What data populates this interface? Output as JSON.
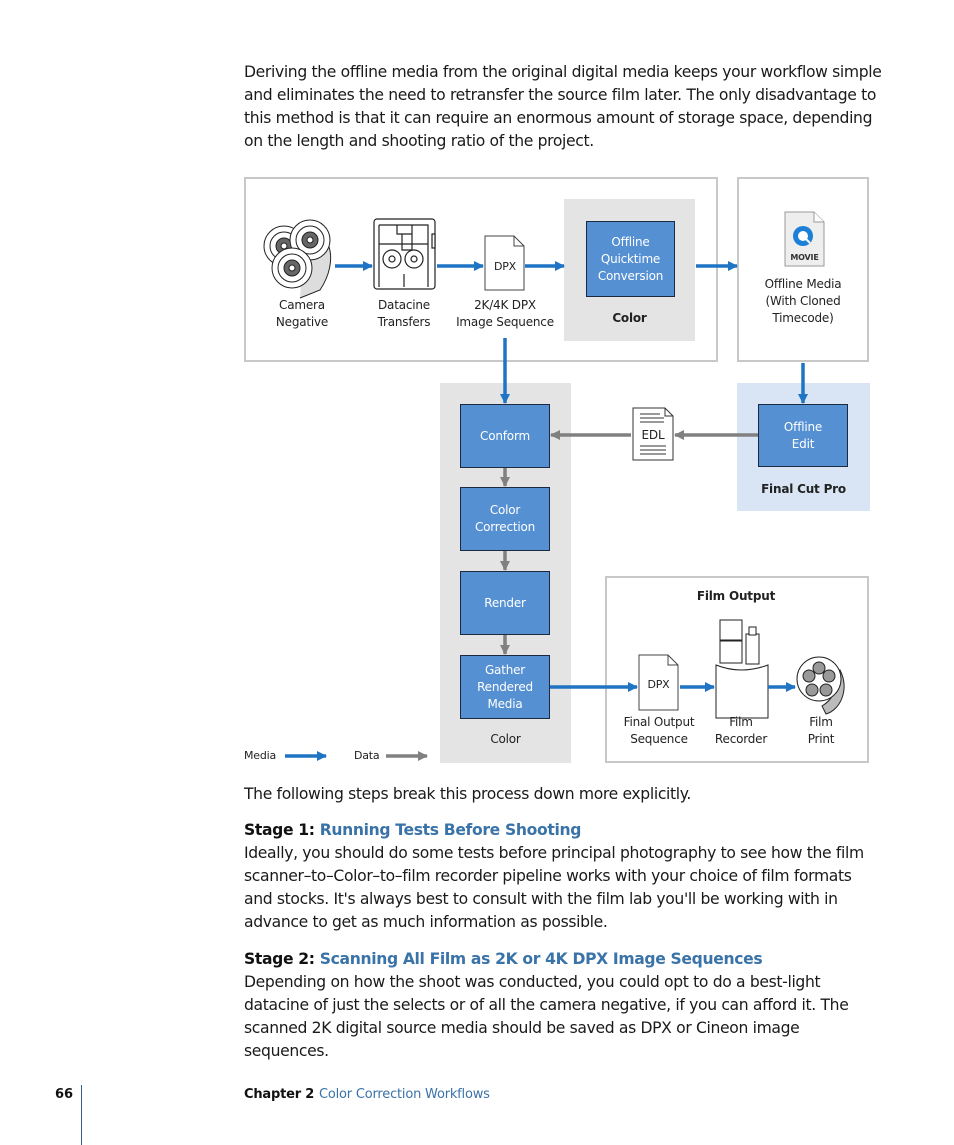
{
  "intro": "Deriving the offline media from the original digital media keeps your workflow simple and eliminates the need to retransfer the source film later. The only disadvantage to this method is that it can require an enormous amount of storage space, depending on the length and shooting ratio of the project.",
  "diagram": {
    "camera_negative": "Camera\nNegative",
    "datacine_transfers": "Datacine\nTransfers",
    "dpx_icon_label": "DPX",
    "image_sequence": "2K/4K DPX\nImage Sequence",
    "offline_quicktime": "Offline\nQuicktime\nConversion",
    "color_top": "Color",
    "movie_icon_label": "MOVIE",
    "offline_media": "Offline Media\n(With Cloned\nTimecode)",
    "offline_edit": "Offline\nEdit",
    "final_cut_pro": "Final Cut Pro",
    "edl_icon_label": "EDL",
    "conform": "Conform",
    "color_correction": "Color\nCorrection",
    "render": "Render",
    "gather_rendered_media": "Gather\nRendered\nMedia",
    "color_bottom": "Color",
    "film_output": "Film Output",
    "dpx_output_icon_label": "DPX",
    "final_output_sequence": "Final Output\nSequence",
    "film_recorder": "Film\nRecorder",
    "film_print": "Film\nPrint",
    "legend_media": "Media",
    "legend_data": "Data",
    "colors": {
      "media_arrow": "#1f74c4",
      "data_arrow": "#808080",
      "process_box": "#5590d3",
      "color_group": "#e4e4e4",
      "fcp_group": "#d9e4f5"
    }
  },
  "steps_intro": "The following steps break this process down more explicitly.",
  "stage1": {
    "prefix": "Stage 1: ",
    "title": "Running Tests Before Shooting",
    "body": "Ideally, you should do some tests before principal photography to see how the film scanner–to–Color–to–film recorder pipeline works with your choice of film formats and stocks. It's always best to consult with the film lab you'll be working with in advance to get as much information as possible."
  },
  "stage2": {
    "prefix": "Stage 2: ",
    "title": "Scanning All Film as 2K or 4K DPX Image Sequences",
    "body": "Depending on how the shoot was conducted, you could opt to do a best-light datacine of just the selects or of all the camera negative, if you can afford it. The scanned 2K digital source media should be saved as DPX or Cineon image sequences."
  },
  "footer": {
    "page_number": "66",
    "chapter": "Chapter 2",
    "chapter_title": "Color Correction Workflows"
  }
}
